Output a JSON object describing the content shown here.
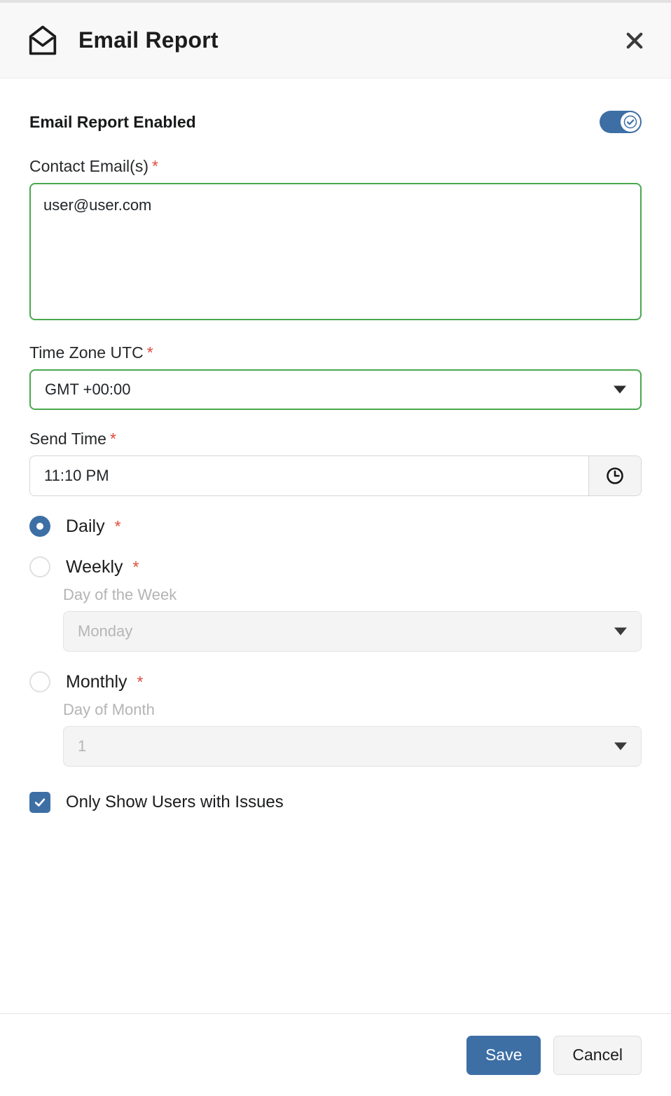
{
  "header": {
    "icon": "open-envelope-icon",
    "title": "Email Report",
    "close_icon": "close-icon"
  },
  "form": {
    "enabled_toggle": {
      "label": "Email Report Enabled",
      "state": "on",
      "accent_color": "#3d6fa5"
    },
    "contact_email": {
      "label": "Contact Email(s)",
      "required_marker": "*",
      "value": "user@user.com",
      "border_color": "#49a84e"
    },
    "time_zone": {
      "label": "Time Zone UTC",
      "required_marker": "*",
      "value": "GMT +00:00",
      "border_color": "#49a84e",
      "caret_icon": "chevron-down-icon"
    },
    "send_time": {
      "label": "Send Time",
      "required_marker": "*",
      "value": "11:10 PM",
      "clock_icon": "clock-icon"
    },
    "frequency": {
      "options": [
        {
          "label": "Daily",
          "required_marker": "*",
          "selected": true
        },
        {
          "label": "Weekly",
          "required_marker": "*",
          "selected": false
        },
        {
          "label": "Monthly",
          "required_marker": "*",
          "selected": false
        }
      ]
    },
    "day_of_week": {
      "label": "Day of the Week",
      "value": "Monday",
      "disabled": true,
      "caret_icon": "chevron-down-icon"
    },
    "day_of_month": {
      "label": "Day of Month",
      "value": "1",
      "disabled": true,
      "caret_icon": "chevron-down-icon"
    },
    "only_issues": {
      "label": "Only Show Users with Issues",
      "checked": true,
      "accent_color": "#3d6fa5"
    }
  },
  "footer": {
    "save_label": "Save",
    "cancel_label": "Cancel"
  }
}
